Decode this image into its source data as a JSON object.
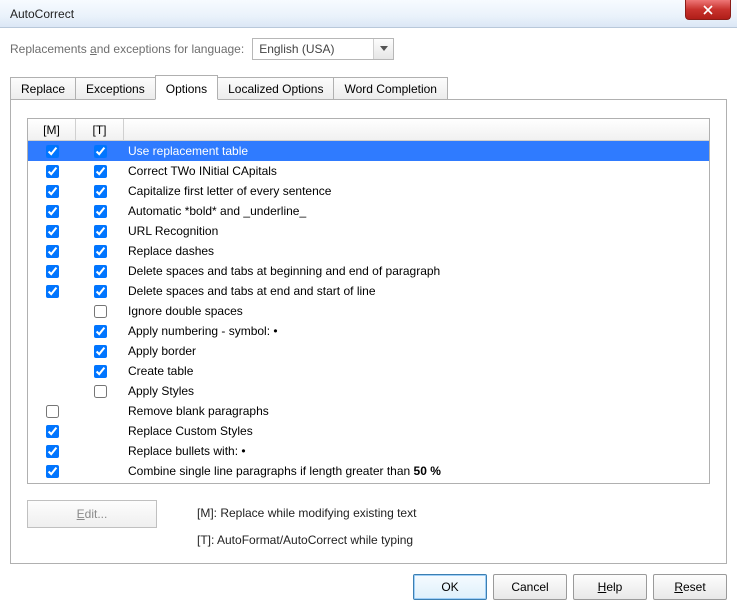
{
  "window": {
    "title": "AutoCorrect"
  },
  "lang": {
    "label_pre": "Replacements ",
    "label_ul": "a",
    "label_post": "nd exceptions for language:",
    "value": "English (USA)"
  },
  "tabs": [
    {
      "label": "Replace",
      "active": false
    },
    {
      "label": "Exceptions",
      "active": false
    },
    {
      "label": "Options",
      "active": true
    },
    {
      "label": "Localized Options",
      "active": false
    },
    {
      "label": "Word Completion",
      "active": false
    }
  ],
  "columns": {
    "m": "[M]",
    "t": "[T]"
  },
  "options": [
    {
      "m": true,
      "t": true,
      "selected": true,
      "label": "Use replacement table"
    },
    {
      "m": true,
      "t": true,
      "selected": false,
      "label": "Correct TWo INitial CApitals"
    },
    {
      "m": true,
      "t": true,
      "selected": false,
      "label": "Capitalize first letter of every sentence"
    },
    {
      "m": true,
      "t": true,
      "selected": false,
      "label": "Automatic *bold* and _underline_"
    },
    {
      "m": true,
      "t": true,
      "selected": false,
      "label": "URL Recognition"
    },
    {
      "m": true,
      "t": true,
      "selected": false,
      "label": "Replace dashes"
    },
    {
      "m": true,
      "t": true,
      "selected": false,
      "label": "Delete spaces and tabs at beginning and end of paragraph"
    },
    {
      "m": true,
      "t": true,
      "selected": false,
      "label": "Delete spaces and tabs at end and start of line"
    },
    {
      "m": null,
      "t": false,
      "selected": false,
      "label": "Ignore double spaces"
    },
    {
      "m": null,
      "t": true,
      "selected": false,
      "label": "Apply numbering - symbol: •"
    },
    {
      "m": null,
      "t": true,
      "selected": false,
      "label": "Apply border"
    },
    {
      "m": null,
      "t": true,
      "selected": false,
      "label": "Create table"
    },
    {
      "m": null,
      "t": false,
      "selected": false,
      "label": "Apply Styles"
    },
    {
      "m": false,
      "t": null,
      "selected": false,
      "label": "Remove blank paragraphs"
    },
    {
      "m": true,
      "t": null,
      "selected": false,
      "label": "Replace Custom Styles"
    },
    {
      "m": true,
      "t": null,
      "selected": false,
      "label": "Replace bullets with: •"
    },
    {
      "m": true,
      "t": null,
      "selected": false,
      "label_html": "Combine single line paragraphs if length greater than <b>50 %</b>",
      "label": "Combine single line paragraphs if length greater than 50 %"
    }
  ],
  "edit": {
    "label_ul": "E",
    "label_post": "dit..."
  },
  "legend": {
    "m": "[M]: Replace while modifying existing text",
    "t": "[T]: AutoFormat/AutoCorrect while typing"
  },
  "buttons": {
    "ok": "OK",
    "cancel": "Cancel",
    "help_ul": "H",
    "help_post": "elp",
    "reset_ul": "R",
    "reset_post": "eset"
  }
}
